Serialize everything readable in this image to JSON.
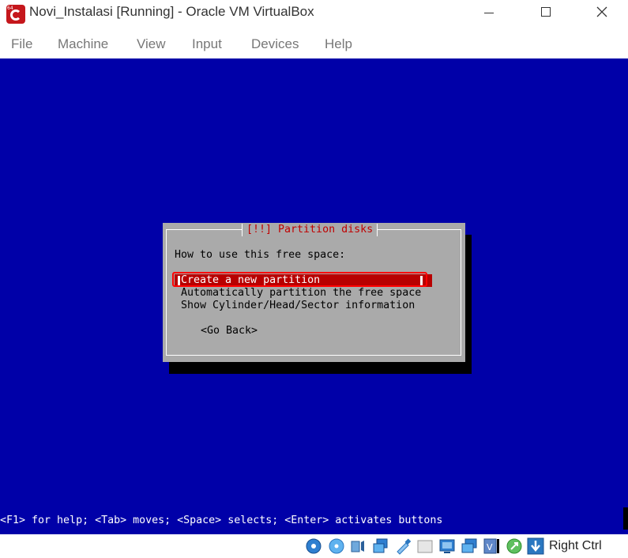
{
  "window": {
    "title": "Novi_Instalasi [Running] - Oracle VM VirtualBox",
    "icon": "virtualbox-vm-icon",
    "icon_tag": "64",
    "controls": [
      "minimize-icon",
      "maximize-icon",
      "close-icon"
    ]
  },
  "menu": {
    "items": [
      {
        "label": "File"
      },
      {
        "label": "Machine"
      },
      {
        "label": "View"
      },
      {
        "label": "Input"
      },
      {
        "label": "Devices"
      },
      {
        "label": "Help"
      }
    ]
  },
  "installer": {
    "background_color": "#0000a8",
    "dialog": {
      "title": "[!!] Partition disks",
      "prompt": "How to use this free space:",
      "options": [
        {
          "label": "Create a new partition",
          "selected": true
        },
        {
          "label": "Automatically partition the free space",
          "selected": false
        },
        {
          "label": "Show Cylinder/Head/Sector information",
          "selected": false
        }
      ],
      "back_button": "<Go Back>",
      "highlight_color": "#ff0000"
    },
    "help_line": "<F1> for help; <Tab> moves; <Space> selects; <Enter> activates buttons"
  },
  "statusbar": {
    "icons": [
      "hard-disk-icon",
      "optical-drive-icon",
      "audio-icon",
      "network-icon",
      "usb-icon",
      "shared-folders-icon",
      "display-icon",
      "video-capture-icon",
      "guest-additions-icon",
      "mouse-integration-icon",
      "host-key-arrow-icon"
    ],
    "host_key": "Right Ctrl"
  }
}
